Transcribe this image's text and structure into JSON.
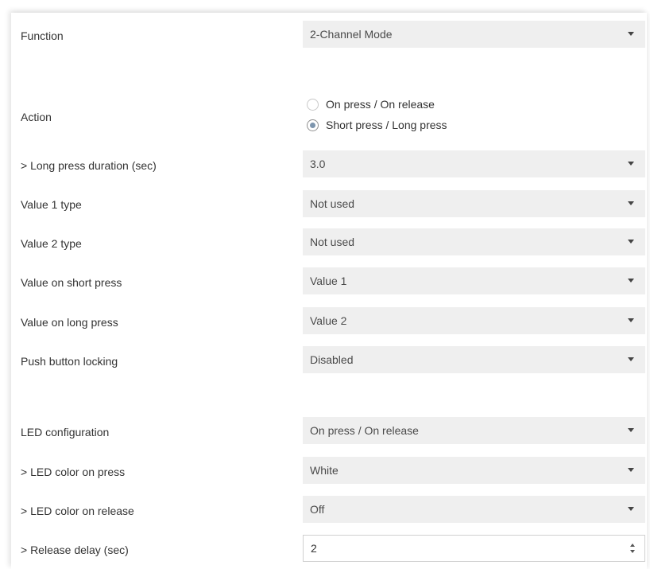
{
  "function": {
    "label": "Function",
    "value": "2-Channel Mode"
  },
  "action": {
    "label": "Action",
    "options": [
      "On press / On release",
      "Short press / Long press"
    ],
    "selected_index": 1
  },
  "long_press_duration": {
    "label": "> Long press duration (sec)",
    "value": "3.0"
  },
  "value1_type": {
    "label": "Value 1 type",
    "value": "Not used"
  },
  "value2_type": {
    "label": "Value 2 type",
    "value": "Not used"
  },
  "value_short_press": {
    "label": "Value on short press",
    "value": "Value 1"
  },
  "value_long_press": {
    "label": "Value on long press",
    "value": "Value 2"
  },
  "push_button_locking": {
    "label": "Push button locking",
    "value": "Disabled"
  },
  "led_configuration": {
    "label": "LED configuration",
    "value": "On press / On release"
  },
  "led_color_press": {
    "label": "> LED color on press",
    "value": "White"
  },
  "led_color_release": {
    "label": "> LED color on release",
    "value": "Off"
  },
  "release_delay": {
    "label": "> Release delay (sec)",
    "value": "2"
  },
  "colors": {
    "field_bg": "#efefef",
    "radio_dot": "#7d95ad"
  }
}
